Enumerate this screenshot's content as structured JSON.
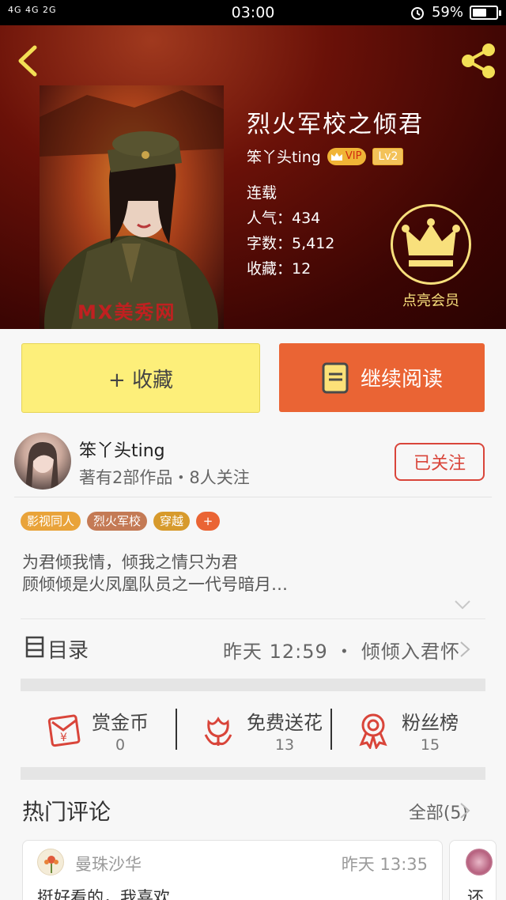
{
  "status_bar": {
    "signal": "4G 4G 2G",
    "time": "03:00",
    "battery_percent": "59%",
    "battery_level": 0.59
  },
  "book": {
    "title": "烈火军校之倾君",
    "author": "笨丫头ting",
    "vip_badge": "VIP",
    "level_badge": "Lv2",
    "status": "连载",
    "popularity": "人气：434",
    "word_count": "字数：5,412",
    "favorites": "收藏：12",
    "cover_watermark": "MX美秀网"
  },
  "member": {
    "label": "点亮会员"
  },
  "actions": {
    "favorite_label": "+ 收藏",
    "read_label": "继续阅读"
  },
  "author": {
    "name": "笨丫头ting",
    "meta": "著有2部作品・8人关注",
    "follow_label": "已关注"
  },
  "tags": [
    {
      "label": "影视同人",
      "color": "#e9a33a"
    },
    {
      "label": "烈火军校",
      "color": "#c47a55"
    },
    {
      "label": "穿越",
      "color": "#d79a2c"
    },
    {
      "label": "+",
      "color": "#ea6434"
    }
  ],
  "summary": {
    "line1": "为君倾我情，倾我之情只为君",
    "line2": "顾倾倾是火凤凰队员之一代号暗月…"
  },
  "catalog": {
    "label": "目录",
    "latest": "昨天 12:59 ・ 倾倾入君怀"
  },
  "rewards": [
    {
      "label": "赏金币",
      "count": "0",
      "icon": "red-envelope-icon"
    },
    {
      "label": "免费送花",
      "count": "13",
      "icon": "flower-icon"
    },
    {
      "label": "粉丝榜",
      "count": "15",
      "icon": "medal-icon"
    }
  ],
  "hot_comments": {
    "title": "热门评论",
    "all_label": "全部(5)",
    "items": [
      {
        "user": "曼珠沙华",
        "time": "昨天 13:35",
        "text": "挺好看的，我喜欢"
      },
      {
        "user": "",
        "time": "",
        "text": "还"
      }
    ]
  },
  "colors": {
    "accent_orange": "#ea6434",
    "favorite_yellow": "#fdef7a",
    "follow_red": "#d9453a",
    "gold": "#f8e07c"
  }
}
